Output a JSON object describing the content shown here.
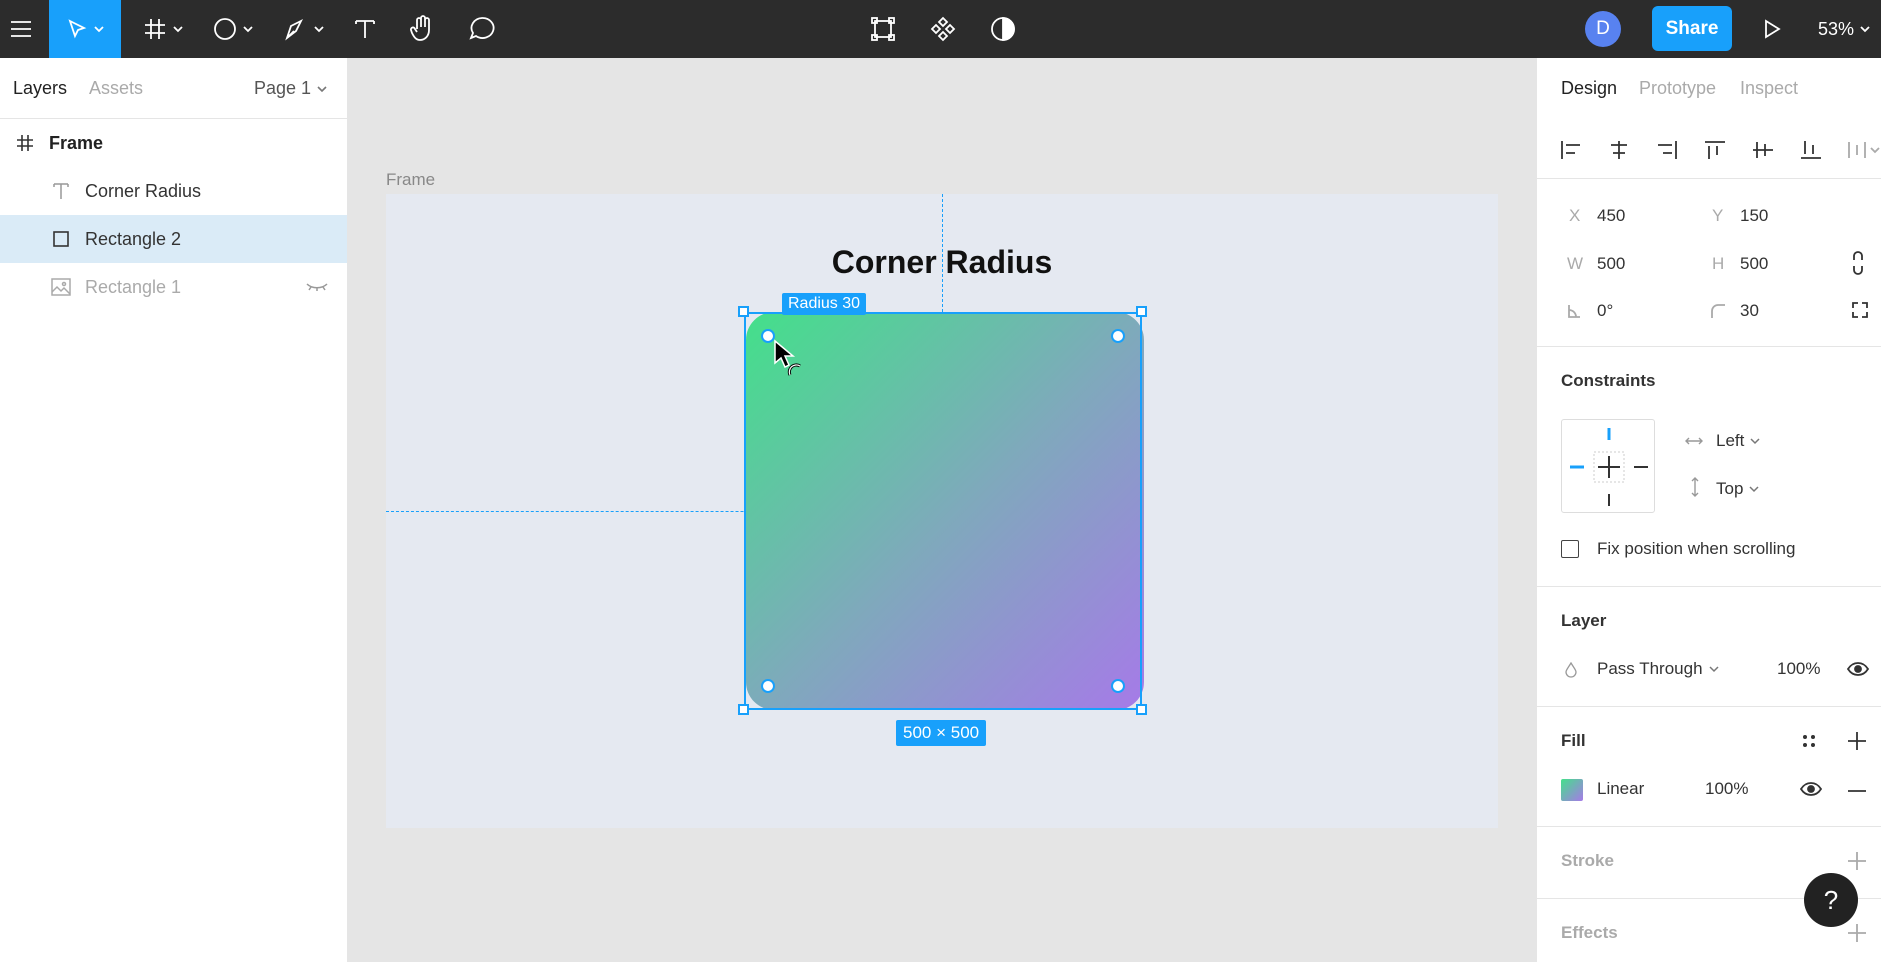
{
  "toolbar": {
    "zoom": "53%",
    "share_label": "Share",
    "avatar_initial": "D"
  },
  "left_panel": {
    "tabs": [
      "Layers",
      "Assets"
    ],
    "page": "Page 1",
    "layers": [
      {
        "name": "Frame",
        "icon": "frame-icon"
      },
      {
        "name": "Corner Radius",
        "icon": "text-icon"
      },
      {
        "name": "Rectangle 2",
        "icon": "rectangle-icon"
      },
      {
        "name": "Rectangle 1",
        "icon": "image-icon"
      }
    ]
  },
  "canvas": {
    "frame_label": "Frame",
    "title": "Corner Radius",
    "radius_label": "Radius 30",
    "size_label": "500 × 500"
  },
  "right_panel": {
    "tabs": [
      "Design",
      "Prototype",
      "Inspect"
    ],
    "x_label": "X",
    "x": "450",
    "y_label": "Y",
    "y": "150",
    "w_label": "W",
    "w": "500",
    "h_label": "H",
    "h": "500",
    "rotation": "0°",
    "radius": "30",
    "constraints_title": "Constraints",
    "h_constraint": "Left",
    "v_constraint": "Top",
    "fix_position": "Fix position when scrolling",
    "layer_title": "Layer",
    "blend_mode": "Pass Through",
    "layer_opacity": "100%",
    "fill_title": "Fill",
    "fill_type": "Linear",
    "fill_opacity": "100%",
    "stroke_title": "Stroke",
    "effects_title": "Effects"
  },
  "help_label": "?"
}
